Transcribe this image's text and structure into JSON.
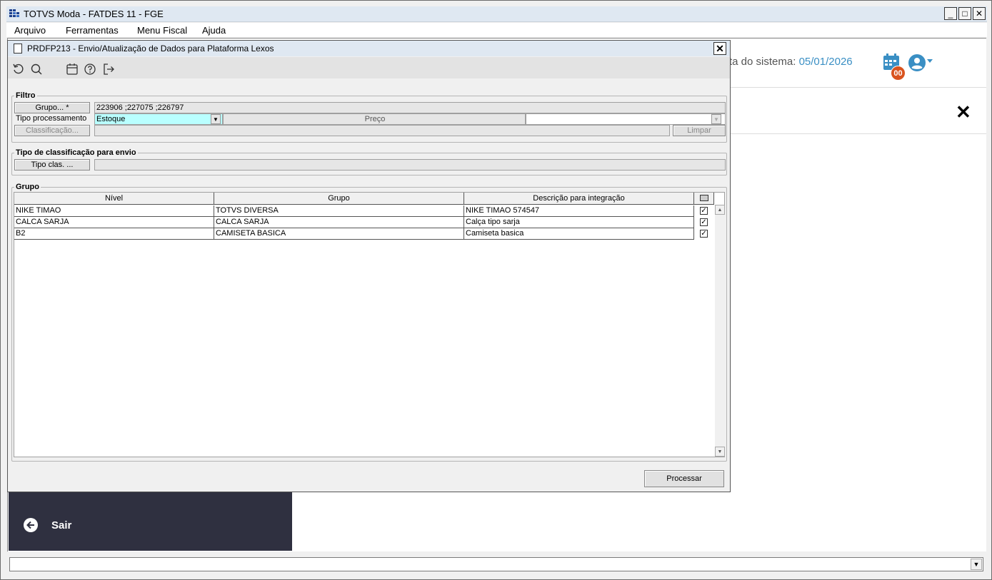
{
  "app": {
    "title": "TOTVS Moda - FATDES 11 - FGE",
    "menu": [
      "Arquivo",
      "Ferramentas",
      "Menu Fiscal",
      "Ajuda"
    ]
  },
  "web": {
    "date_label": "ta do sistema:",
    "date_value": "05/01/2026",
    "badge": "00",
    "sair_label": "Sair",
    "accent_color": "#3a8fc4",
    "badge_color": "#d9531e",
    "panel_color": "#2f3040"
  },
  "dialog": {
    "title": "PRDFP213 - Envio/Atualização de Dados para Plataforma Lexos",
    "toolbar_icons": [
      "refresh-icon",
      "search-icon",
      "calendar-icon",
      "help-icon",
      "exit-icon"
    ],
    "filtro": {
      "legend": "Filtro",
      "grupo_button": "Grupo... *",
      "grupo_value": "223906 ;227075 ;226797",
      "tipo_label": "Tipo processamento",
      "tipo_value": "Estoque",
      "preco_label": "Preço",
      "classificacao_button": "Classificação...",
      "limpar_button": "Limpar"
    },
    "tipo_classificacao": {
      "legend": "Tipo de classificação para envio",
      "button": "Tipo clas. ..."
    },
    "grupo": {
      "legend": "Grupo",
      "headers": [
        "Nível",
        "Grupo",
        "Descrição para integração"
      ],
      "rows": [
        {
          "nivel": "NIKE TIMAO",
          "grupo": "TOTVS DIVERSA",
          "descricao": "NIKE TIMAO 574547",
          "checked": true
        },
        {
          "nivel": "CALCA SARJA",
          "grupo": "CALCA SARJA",
          "descricao": "Calça tipo sarja",
          "checked": true
        },
        {
          "nivel": "B2",
          "grupo": "CAMISETA BASICA",
          "descricao": "Camiseta basica",
          "checked": true
        }
      ]
    },
    "processar_button": "Processar"
  }
}
